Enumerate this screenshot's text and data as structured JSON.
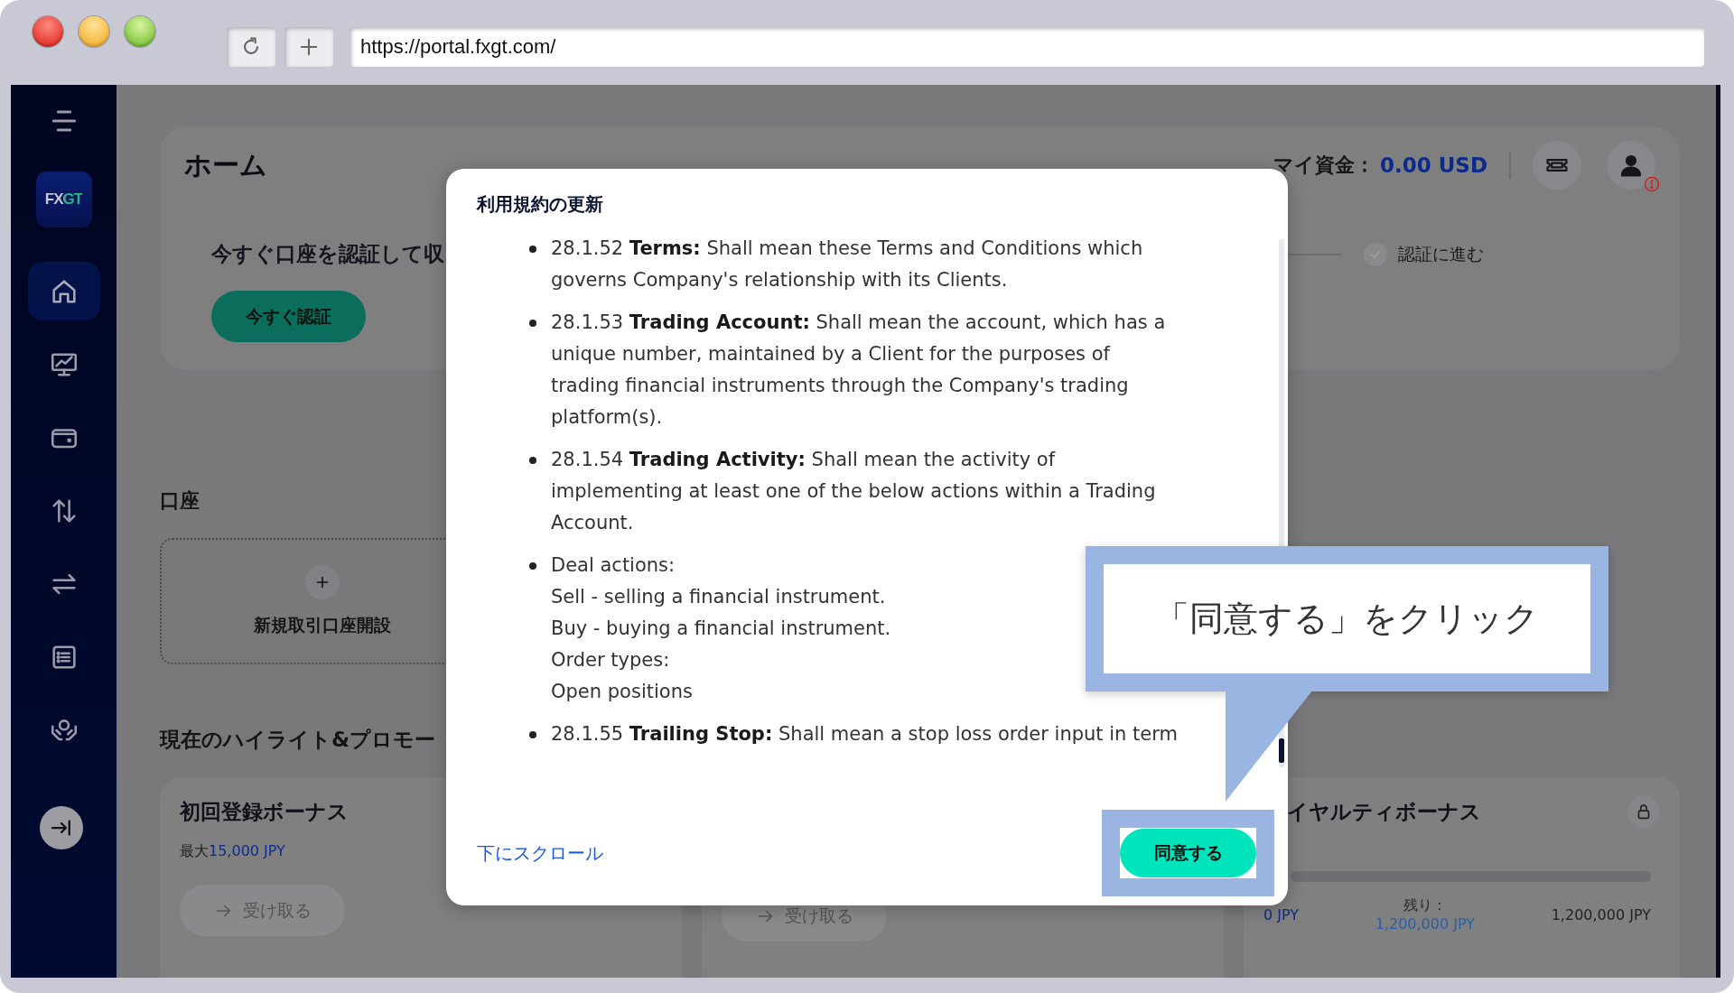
{
  "browser": {
    "url": "https://portal.fxgt.com/"
  },
  "sidebar": {
    "logo": "FXGT",
    "items": [
      {
        "selected": true
      },
      {
        "selected": false
      },
      {
        "selected": false
      },
      {
        "selected": false
      },
      {
        "selected": false
      },
      {
        "selected": false
      },
      {
        "selected": false
      }
    ]
  },
  "home": {
    "title": "ホーム",
    "balance_label": "マイ資金：",
    "balance_value": "0.00 USD",
    "profile_alert": true,
    "verify_text": "今すぐ口座を認証して収",
    "verify_button": "今すぐ認証",
    "step_label": "認証に進む"
  },
  "accounts": {
    "heading": "口座",
    "new_account": "新規取引口座開設"
  },
  "promotions": {
    "heading": "現在のハイライト&プロモー",
    "cards": [
      {
        "title": "初回登録ボーナス",
        "subtitle_prefix": "最大",
        "subtitle_value": "15,000 JPY",
        "button": "受け取る"
      },
      {
        "button": "受け取る"
      },
      {
        "title": "イヤルティボーナス",
        "locked": true,
        "level": 0,
        "start": "0 JPY",
        "remaining_label": "残り：",
        "remaining": "1,200,000 JPY",
        "end": "1,200,000 JPY"
      }
    ]
  },
  "modal": {
    "title": "利用規約の更新",
    "items": [
      {
        "kind": "definition",
        "text": "28.1.52 **Terms:** Shall mean these Terms and Conditions which governs Company's relationship with its Clients."
      },
      {
        "kind": "definition",
        "text": "28.1.53 **Trading Account:** Shall mean the account, which has a unique number, maintained by a Client for the purposes of trading financial instruments through the Company's trading platform(s)."
      },
      {
        "kind": "definition",
        "text": "28.1.54 **Trading Activity:** Shall mean the activity of implementing at least one of the below actions within a Trading Account."
      },
      {
        "kind": "lines",
        "lines": [
          "Deal actions:",
          "Sell - selling a financial instrument.",
          "Buy - buying a financial instrument.",
          "Order types:",
          "Open positions"
        ]
      },
      {
        "kind": "definition",
        "text": "28.1.55 **Trailing Stop:** Shall mean a stop loss order input in term"
      }
    ],
    "scroll_link": "下にスクロール",
    "agree_button": "同意する"
  },
  "callout": {
    "text": "「同意する」をクリック"
  }
}
